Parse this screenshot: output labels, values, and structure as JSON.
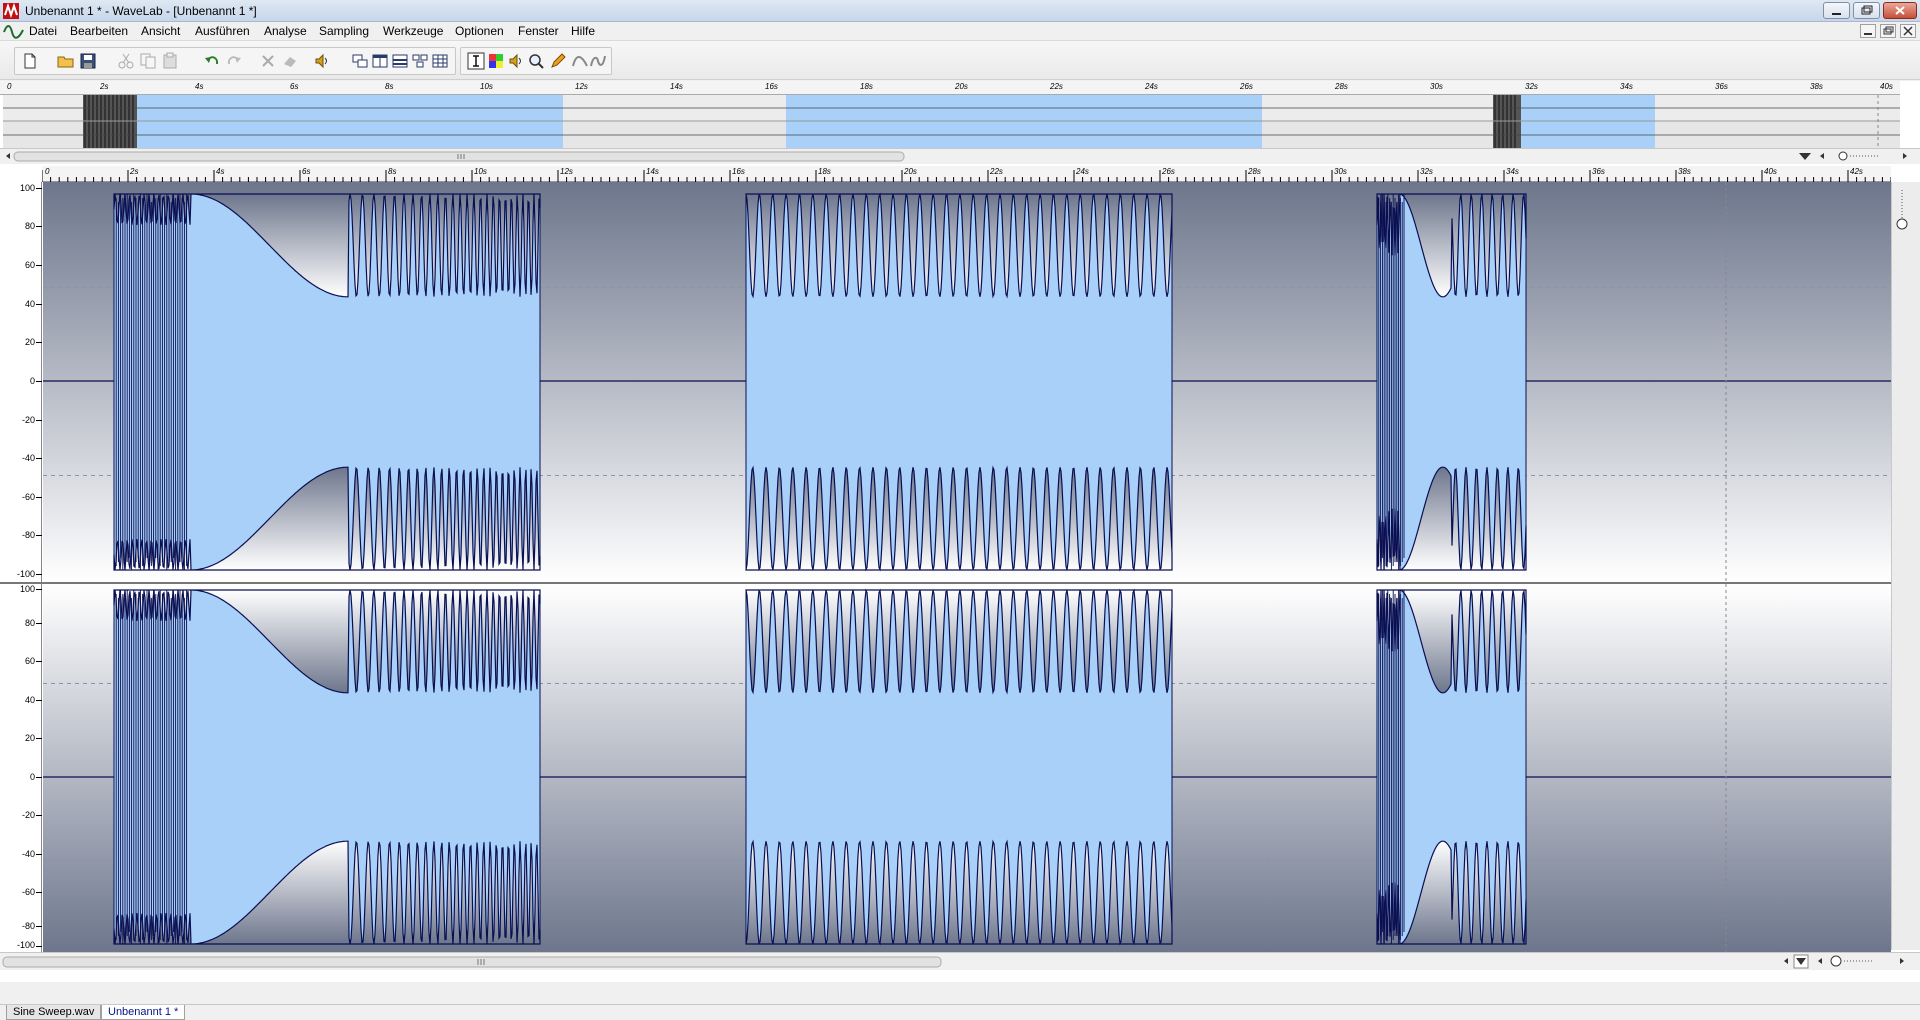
{
  "window": {
    "title": "Unbenannt 1 * - WaveLab - [Unbenannt 1 *]"
  },
  "menu": {
    "items": [
      "Datei",
      "Bearbeiten",
      "Ansicht",
      "Ausführen",
      "Analyse",
      "Sampling",
      "Werkzeuge",
      "Optionen",
      "Fenster",
      "Hilfe"
    ]
  },
  "toolbar": {
    "icons": [
      "new-file-icon",
      "open-folder-icon",
      "save-icon",
      "cut-icon",
      "copy-icon",
      "paste-icon",
      "undo-icon",
      "redo-icon",
      "delete-icon",
      "eraser-icon",
      "speaker-icon",
      "window-layout-icon",
      "split-view-icon",
      "horizontal-split-icon",
      "tile-icon",
      "grid-icon",
      "text-cursor-icon",
      "color-picker-icon",
      "play-speaker-icon",
      "zoom-icon",
      "pencil-icon",
      "curve-icon",
      "wave-tool-icon"
    ]
  },
  "overview_ruler": {
    "labels": [
      "0",
      "2s",
      "4s",
      "6s",
      "8s",
      "10s",
      "12s",
      "14s",
      "16s",
      "18s",
      "20s",
      "22s",
      "24s",
      "26s",
      "28s",
      "30s",
      "32s",
      "34s",
      "36s",
      "38s",
      "40s"
    ]
  },
  "main_ruler": {
    "labels": [
      "0",
      "2s",
      "4s",
      "6s",
      "8s",
      "10s",
      "12s",
      "14s",
      "16s",
      "18s",
      "20s",
      "22s",
      "24s",
      "26s",
      "28s",
      "30s",
      "32s",
      "34s",
      "36s",
      "38s",
      "40s",
      "42s"
    ]
  },
  "amplitude_axis": {
    "labels": [
      "100",
      "80",
      "60",
      "40",
      "20",
      "0",
      "-20",
      "-40",
      "-60",
      "-80",
      "-100"
    ]
  },
  "tabs": [
    "Sine Sweep.wav",
    "Unbenannt 1 *"
  ],
  "colors": {
    "selection": "#a8d0f8",
    "waveform": "#0a0f52",
    "active_tab_text": "#00178a"
  }
}
